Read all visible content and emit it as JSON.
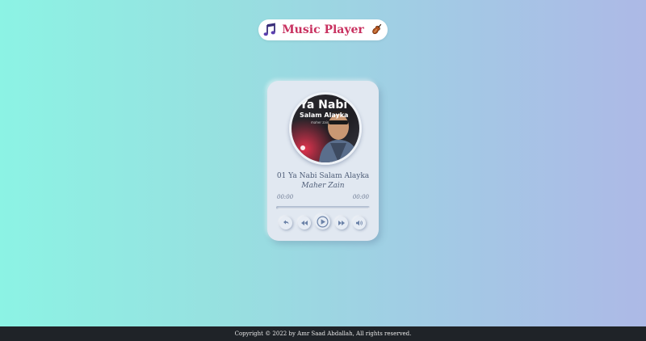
{
  "header": {
    "title": "Music Player",
    "left_icon": "music-notes-icon",
    "right_icon": "violin-icon",
    "title_color": "#c8305f"
  },
  "player": {
    "cover": {
      "headline": "Ya Nabi",
      "subline": "Salam Alayka",
      "small_text": "maher zain"
    },
    "song_title": "01 Ya Nabi Salam Alayka",
    "artist": "Maher Zain",
    "current_time": "00:00",
    "total_time": "00:00",
    "progress": 0,
    "controls": [
      {
        "name": "repeat-icon"
      },
      {
        "name": "rewind-icon"
      },
      {
        "name": "play-icon"
      },
      {
        "name": "fast-forward-icon"
      },
      {
        "name": "volume-icon"
      }
    ],
    "accent_color": "#6b82a8"
  },
  "footer": {
    "copyright": "Copyright © 2022 by Amr Saad Abdallah, All rights reserved."
  }
}
